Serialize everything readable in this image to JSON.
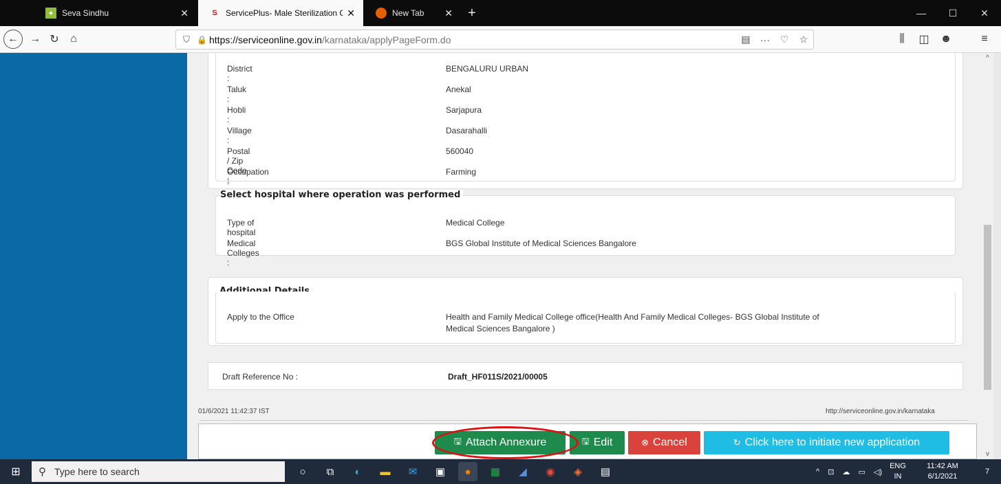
{
  "browser": {
    "tabs": [
      {
        "label": "Seva Sindhu",
        "icon": "seva-sindhu-favicon"
      },
      {
        "label": "ServicePlus- Male Sterilization C",
        "icon": "serviceplus-favicon"
      },
      {
        "label": "New Tab",
        "icon": "firefox-favicon"
      }
    ],
    "new_tab_symbol": "+",
    "url_host": "https://serviceonline.gov.in",
    "url_path": "/karnataka/applyPageForm.do"
  },
  "address": {
    "rows": [
      {
        "label": "District :",
        "value": "BENGALURU URBAN"
      },
      {
        "label": "Taluk :",
        "value": "Anekal"
      },
      {
        "label": "Hobli :",
        "value": "Sarjapura"
      },
      {
        "label": "Village :",
        "value": "Dasarahalli"
      },
      {
        "label": "Postal / Zip Code :",
        "value": "560040"
      },
      {
        "label": "Occupation :",
        "value": "Farming"
      }
    ]
  },
  "hospital": {
    "legend": "Select hospital where operation was performed",
    "rows": [
      {
        "label": "Type of hospital :",
        "value": "Medical College"
      },
      {
        "label": "Medical Colleges :",
        "value": "BGS Global Institute of Medical Sciences Bangalore"
      }
    ]
  },
  "additional": {
    "legend": "Additional Details",
    "label": "Apply to the Office",
    "value_line1": "Health and Family Medical College office(Health And Family Medical Colleges- BGS Global Institute of",
    "value_line2": "Medical Sciences Bangalore )"
  },
  "draft": {
    "label": "Draft Reference No :",
    "value": "Draft_HF011S/2021/00005"
  },
  "footer": {
    "timestamp": "01/6/2021 11:42:37 IST",
    "site": "http://serviceonline.gov.in/karnataka"
  },
  "actions": {
    "attach": "Attach Annexure",
    "edit": "Edit",
    "cancel": "Cancel",
    "new_app": "Click here to initiate new application"
  },
  "taskbar": {
    "search_placeholder": "Type here to search",
    "lang_line1": "ENG",
    "lang_line2": "IN",
    "time": "11:42 AM",
    "date": "6/1/2021",
    "notifications": "7"
  },
  "colors": {
    "sidebar": "#0a6aa6",
    "green": "#1e8a4c",
    "red": "#d9433b",
    "cyan": "#1fbde3",
    "highlight": "#dd1111"
  }
}
